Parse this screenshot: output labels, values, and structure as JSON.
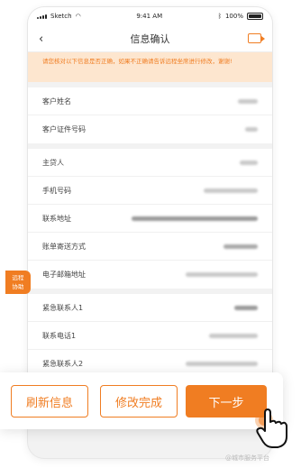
{
  "status_bar": {
    "carrier": "Sketch",
    "time": "9:41 AM",
    "battery": "100%"
  },
  "navbar": {
    "title": "信息确认"
  },
  "notice": "请您核对以下信息是否正确，如果不正确请告诉远程坐席进行修改，谢谢!",
  "groups": [
    {
      "rows": [
        {
          "label": "客户姓名"
        },
        {
          "label": "客户证件号码"
        }
      ]
    },
    {
      "rows": [
        {
          "label": "主贷人"
        },
        {
          "label": "手机号码"
        },
        {
          "label": "联系地址"
        },
        {
          "label": "账单寄送方式"
        },
        {
          "label": "电子邮箱地址"
        }
      ]
    },
    {
      "rows": [
        {
          "label": "紧急联系人1"
        },
        {
          "label": "联系电话1"
        },
        {
          "label": "紧急联系人2"
        }
      ]
    }
  ],
  "remote_tag": {
    "line1": "远程",
    "line2": "协助"
  },
  "buttons": {
    "refresh": "刷新信息",
    "modify": "修改完成",
    "next": "下一步"
  },
  "watermark": "@城市服务平台"
}
